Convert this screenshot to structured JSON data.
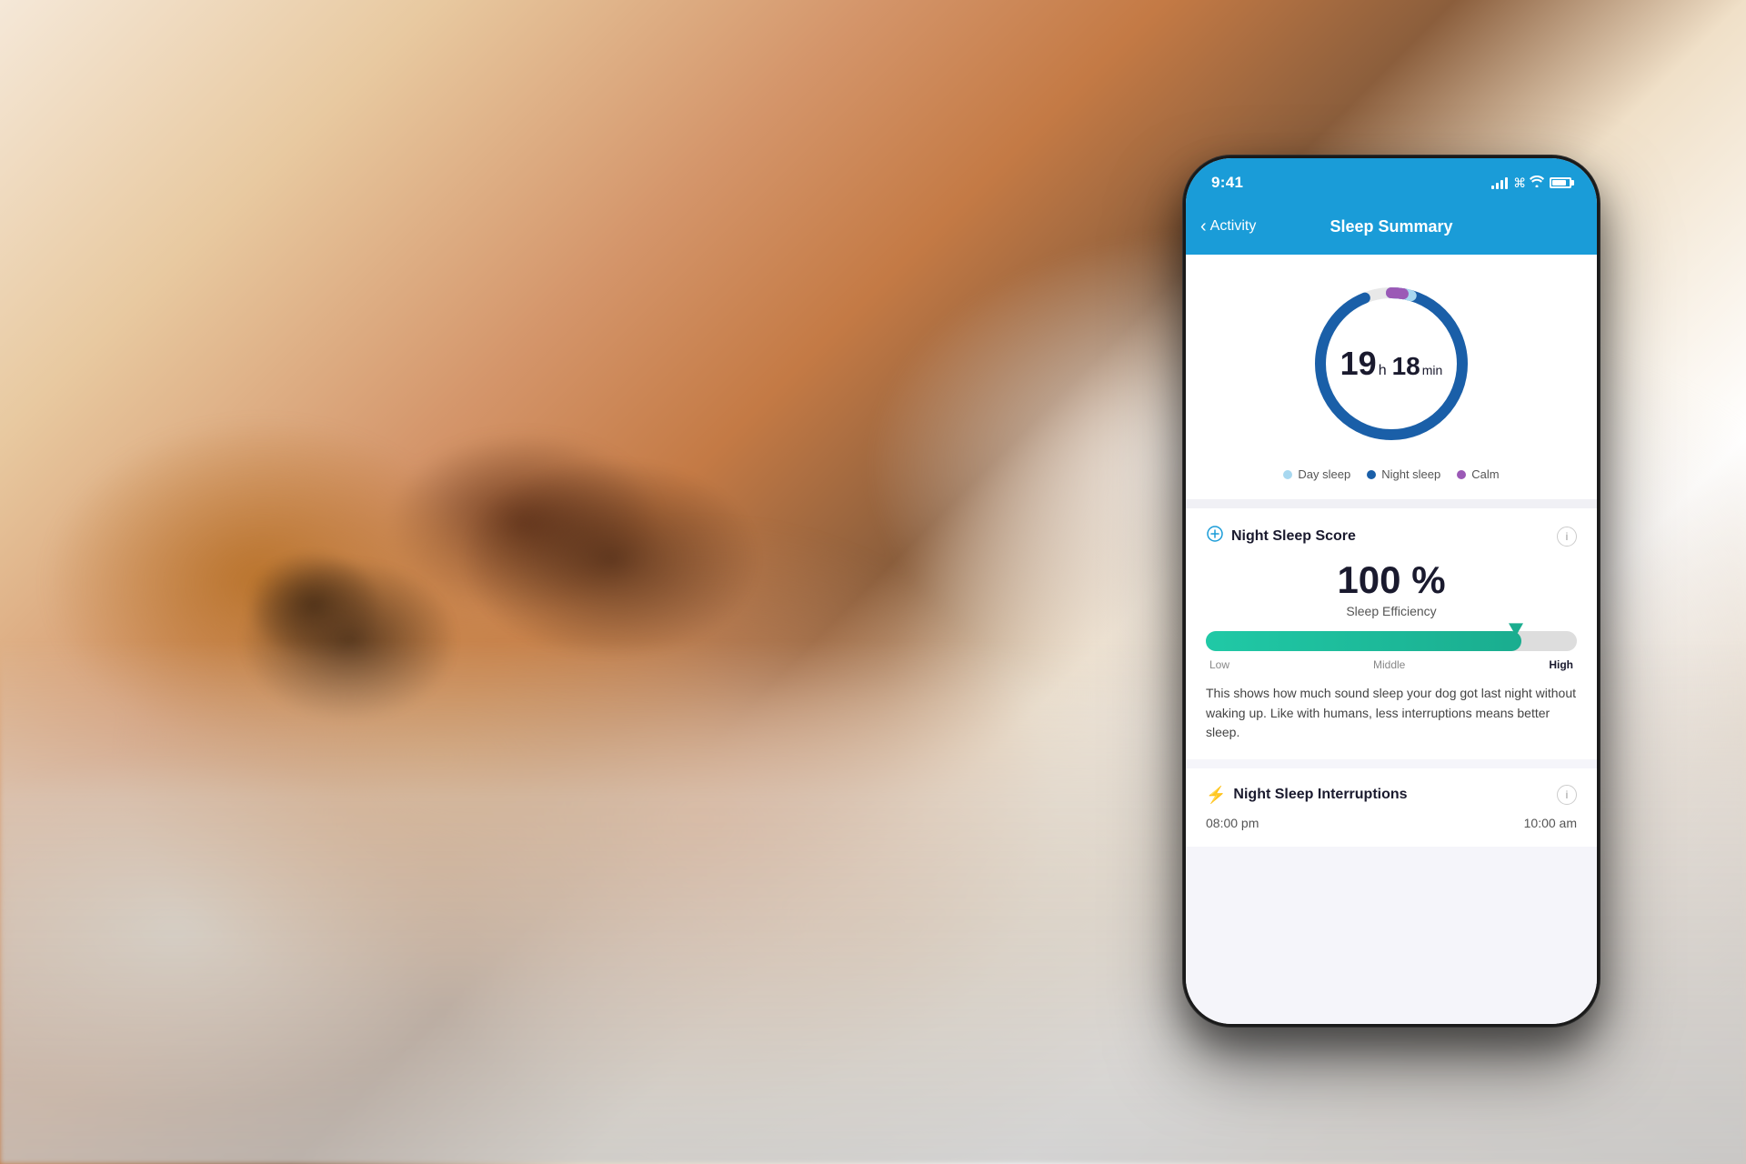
{
  "background": {
    "alt": "Sleeping dog on pillow"
  },
  "phone": {
    "status_bar": {
      "time": "9:41",
      "signal_label": "signal",
      "wifi_label": "wifi",
      "battery_label": "battery"
    },
    "nav": {
      "back_label": "Activity",
      "title": "Sleep Summary"
    },
    "sleep_circle": {
      "hours": "19",
      "h_unit": "h",
      "minutes": "18",
      "min_unit": "min"
    },
    "legend": {
      "day_sleep": "Day sleep",
      "night_sleep": "Night sleep",
      "calm": "Calm"
    },
    "night_sleep_score": {
      "section_title": "Night Sleep Score",
      "score_value": "100 %",
      "score_label": "Sleep Efficiency",
      "progress_low": "Low",
      "progress_middle": "Middle",
      "progress_high": "High",
      "description": "This shows how much sound sleep your dog got last night without waking up. Like with humans, less interruptions means better sleep."
    },
    "night_sleep_interruptions": {
      "section_title": "Night Sleep Interruptions",
      "time_start": "08:00 pm",
      "time_end": "10:00 am"
    },
    "info_icon_label": "i"
  },
  "colors": {
    "accent_blue": "#1a9cd8",
    "night_sleep": "#1a5fa8",
    "day_sleep": "#a8d8f0",
    "calm": "#9b59b6",
    "teal": "#20c9a6",
    "gold": "#f0a500"
  }
}
